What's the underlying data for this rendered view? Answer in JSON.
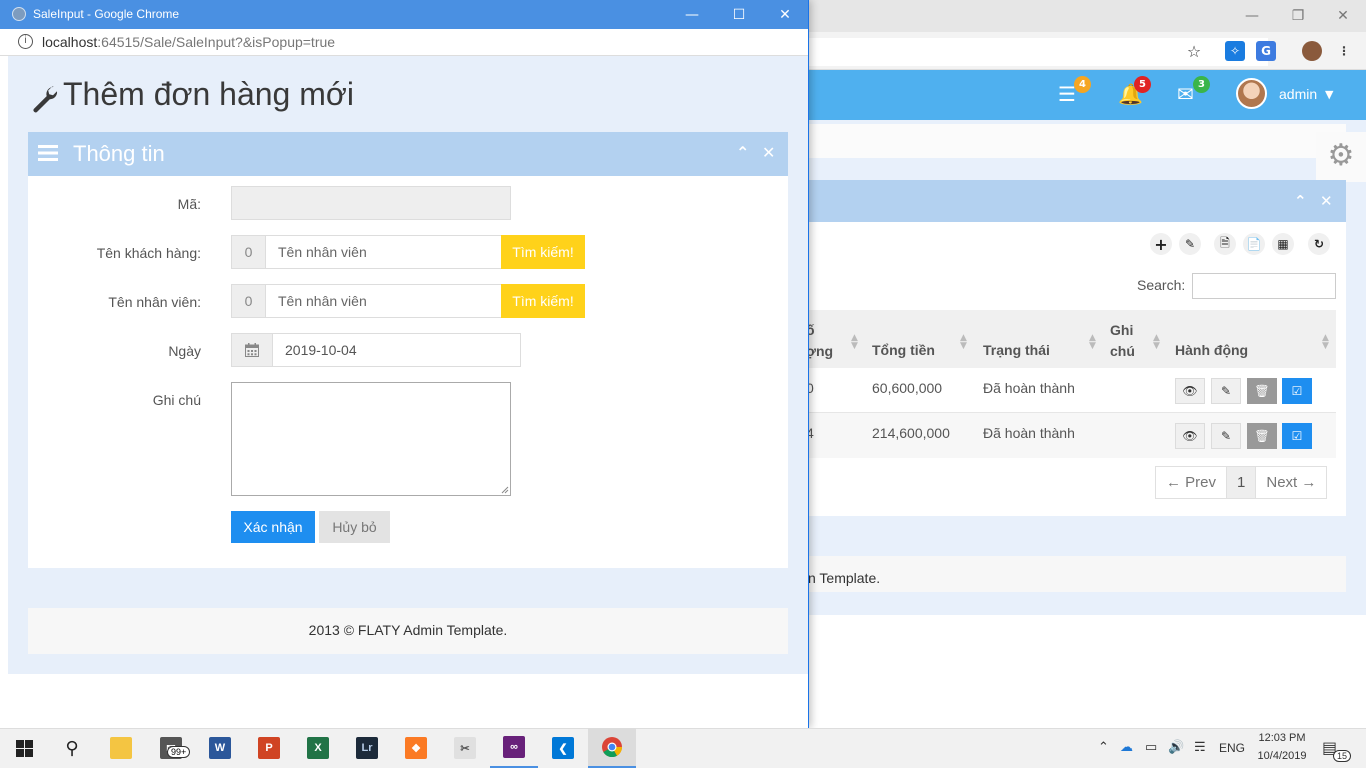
{
  "popup": {
    "window_title": "SaleInput - Google Chrome",
    "url_host": "localhost",
    "url_rest": ":64515/Sale/SaleInput?&isPopup=true",
    "page_title": "Thêm đơn hàng mới",
    "box_title": "Thông tin",
    "form": {
      "ma_label": "Mã:",
      "customer_label": "Tên khách hàng:",
      "customer_id": "0",
      "customer_placeholder": "Tên nhân viên",
      "employee_label": "Tên nhân viên:",
      "employee_id": "0",
      "employee_placeholder": "Tên nhân viên",
      "search_label": "Tìm kiếm!",
      "date_label": "Ngày",
      "date_value": "2019-10-04",
      "note_label": "Ghi chú",
      "submit_label": "Xác nhận",
      "cancel_label": "Hủy bỏ"
    },
    "footer": "2013 © FLATY Admin Template."
  },
  "background": {
    "navbar": {
      "tasks_count": "4",
      "notifications_count": "5",
      "messages_count": "3",
      "user_name": "admin"
    },
    "search_label": "Search:",
    "table": {
      "headers": [
        "ố\nợng",
        "Tổng tiền",
        "Trạng thái",
        "Ghi\nchú",
        "Hành động"
      ],
      "rows": [
        {
          "qty": "0",
          "total": "60,600,000",
          "status": "Đã hoàn thành"
        },
        {
          "qty": "4",
          "total": "214,600,000",
          "status": "Đã hoàn thành"
        }
      ]
    },
    "pager": {
      "prev": "← Prev",
      "current": "1",
      "next": "Next →"
    },
    "footer_fragment": "n Template."
  },
  "taskbar": {
    "mail_badge": "99+",
    "language": "ENG",
    "time": "12:03 PM",
    "date": "10/4/2019",
    "notification_count": "15"
  },
  "colors": {
    "navbar": "#4fb0ef",
    "box_header": "#b3d1f0",
    "search_button": "#ffd21a",
    "primary_button": "#1e8ef0",
    "popup_titlebar": "#4a90e2"
  }
}
